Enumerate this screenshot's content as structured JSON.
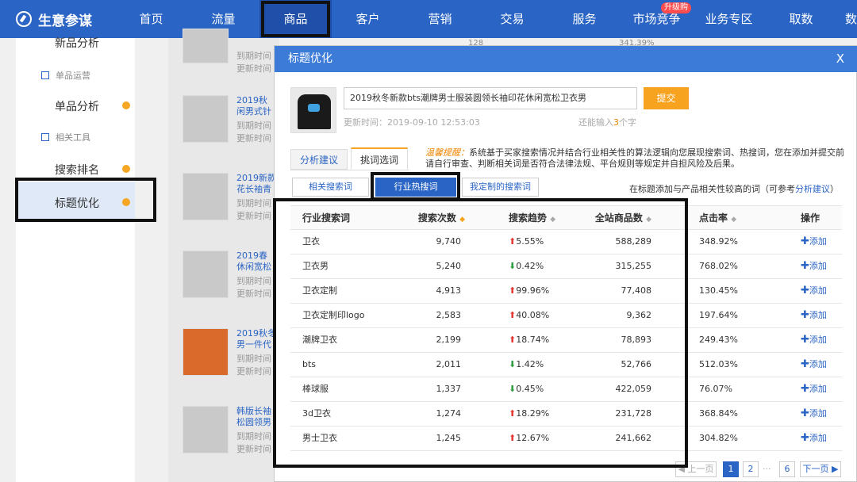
{
  "brand": {
    "name": "生意参谋"
  },
  "nav": {
    "items": [
      "首页",
      "流量",
      "商品",
      "客户",
      "营销",
      "交易",
      "服务",
      "市场竞争",
      "业务专区",
      "取数",
      "数"
    ],
    "badge": "升级购"
  },
  "sidebar": {
    "item_top": "新品分析",
    "group1": "单品运营",
    "item_single": "单品分析",
    "group2": "相关工具",
    "item_rank": "搜索排名",
    "item_title": "标题优化"
  },
  "background_list": {
    "items": [
      {
        "title": "",
        "line1": "到期时间",
        "line2": "更新时间"
      },
      {
        "title": "2019秋",
        "title2": "闲男式针",
        "line1": "到期时间",
        "line2": "更新时间"
      },
      {
        "title": "2019新款",
        "title2": "花长袖青",
        "line1": "到期时间",
        "line2": "更新时间"
      },
      {
        "title": "2019春",
        "title2": "休闲宽松",
        "line1": "到期时间",
        "line2": "更新时间"
      },
      {
        "title": "2019秋冬",
        "title2": "男一件代",
        "line1": "到期时间",
        "line2": "更新时间"
      },
      {
        "title": "韩版长袖",
        "title2": "松圆领男",
        "line1": "到期时间",
        "line2": "更新时间"
      }
    ]
  },
  "modal": {
    "title": "标题优化",
    "close": "X",
    "product_title": "2019秋冬新款bts潮牌男士服装圆领长袖印花休闲宽松卫衣男",
    "submit": "提交",
    "update_time": "更新时间：2019-09-10 12:53:03",
    "remain_prefix": "还能输入",
    "remain_count": "3",
    "remain_suffix": "个字",
    "tabs": {
      "analysis": "分析建议",
      "pick": "挑词选词"
    },
    "tip_label": "温馨提醒：",
    "tip_text": "系统基于买家搜索情况并结合行业相关性的算法逻辑向您展现搜索词、热搜词，您在添加并提交前请自行审查、判断相关词是否符合法律法规、平台规则等规定并自担风险及后果。",
    "subtabs": {
      "related": "相关搜索词",
      "hot": "行业热搜词",
      "custom": "我定制的搜索词"
    },
    "note_prefix": "在标题添加与产品相关性较高的词（可参考",
    "note_link": "分析建议",
    "note_suffix": "）",
    "table": {
      "headers": [
        "行业搜索词",
        "搜索次数",
        "搜索趋势",
        "全站商品数",
        "点击率",
        "操作"
      ],
      "add_label": "添加",
      "rows": [
        {
          "word": "卫衣",
          "count": "9,740",
          "dir": "up",
          "trend": "5.55%",
          "goods": "588,289",
          "ctr": "348.92%"
        },
        {
          "word": "卫衣男",
          "count": "5,240",
          "dir": "down",
          "trend": "0.42%",
          "goods": "315,255",
          "ctr": "768.02%"
        },
        {
          "word": "卫衣定制",
          "count": "4,913",
          "dir": "up",
          "trend": "99.96%",
          "goods": "77,408",
          "ctr": "130.45%"
        },
        {
          "word": "卫衣定制印logo",
          "count": "2,583",
          "dir": "up",
          "trend": "40.08%",
          "goods": "9,362",
          "ctr": "197.64%"
        },
        {
          "word": "潮牌卫衣",
          "count": "2,199",
          "dir": "up",
          "trend": "18.74%",
          "goods": "78,893",
          "ctr": "249.43%"
        },
        {
          "word": "bts",
          "count": "2,011",
          "dir": "down",
          "trend": "1.42%",
          "goods": "52,766",
          "ctr": "512.03%"
        },
        {
          "word": "棒球服",
          "count": "1,337",
          "dir": "down",
          "trend": "0.45%",
          "goods": "422,059",
          "ctr": "76.07%"
        },
        {
          "word": "3d卫衣",
          "count": "1,274",
          "dir": "up",
          "trend": "18.29%",
          "goods": "231,728",
          "ctr": "368.84%"
        },
        {
          "word": "男士卫衣",
          "count": "1,245",
          "dir": "up",
          "trend": "12.67%",
          "goods": "241,662",
          "ctr": "304.82%"
        }
      ]
    },
    "pager": {
      "prev": "上一页",
      "p1": "1",
      "p2": "2",
      "dots": "...",
      "p6": "6",
      "next": "下一页"
    }
  },
  "bg_trend": {
    "count": "128",
    "pct": "341.39%"
  }
}
